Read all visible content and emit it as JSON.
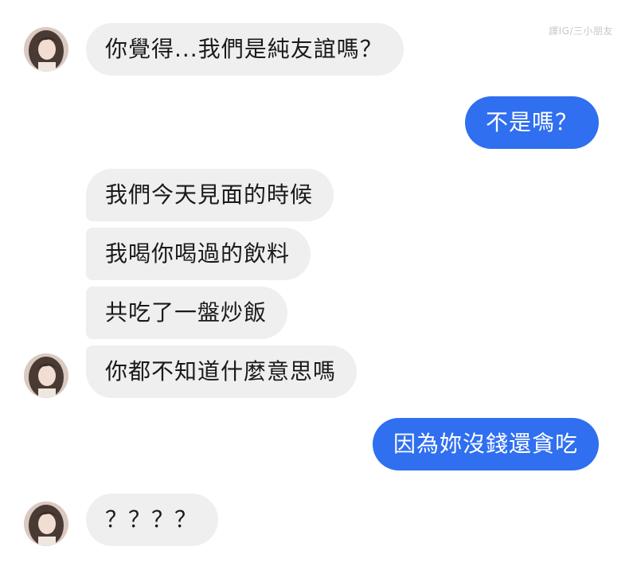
{
  "watermark": "譯IG/三小朋友",
  "messages": [
    {
      "side": "incoming",
      "text": "你覺得...我們是純友誼嗎？"
    },
    {
      "side": "outgoing",
      "text": "不是嗎？"
    },
    {
      "side": "incoming",
      "text": "我們今天見面的時候"
    },
    {
      "side": "incoming",
      "text": "我喝你喝過的飲料"
    },
    {
      "side": "incoming",
      "text": "共吃了一盤炒飯"
    },
    {
      "side": "incoming",
      "text": "你都不知道什麼意思嗎"
    },
    {
      "side": "outgoing",
      "text": "因為妳沒錢還貪吃"
    },
    {
      "side": "incoming",
      "text": "？？？？"
    }
  ],
  "colors": {
    "incoming_bubble": "#efefef",
    "outgoing_bubble": "#2f6ff0",
    "outgoing_text": "#ffffff",
    "incoming_text": "#1a1a1a"
  },
  "icons": {
    "avatar": "contact-avatar-photo"
  }
}
